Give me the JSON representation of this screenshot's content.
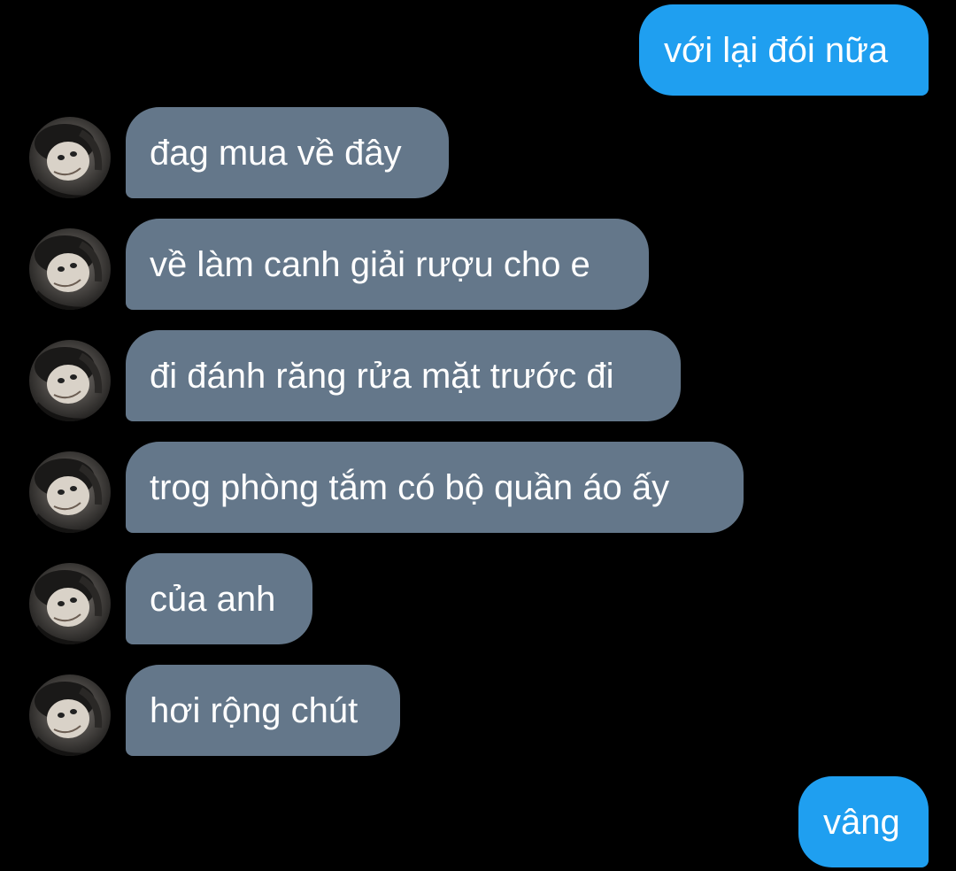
{
  "messages": [
    {
      "side": "sent",
      "text": "với lại đói nữa"
    },
    {
      "side": "received",
      "text": "đag mua về đây",
      "avatar": "user-photo-avatar"
    },
    {
      "side": "received",
      "text": "về làm canh giải rượu cho e",
      "avatar": "user-photo-avatar"
    },
    {
      "side": "received",
      "text": "đi đánh răng rửa mặt trước đi",
      "avatar": "user-photo-avatar"
    },
    {
      "side": "received",
      "text": "trog phòng tắm có bộ quần áo ấy",
      "avatar": "user-photo-avatar"
    },
    {
      "side": "received",
      "text": "của anh",
      "avatar": "user-photo-avatar"
    },
    {
      "side": "received",
      "text": "hơi rộng chút",
      "avatar": "user-photo-avatar"
    },
    {
      "side": "sent",
      "text": "vâng"
    }
  ],
  "colors": {
    "background": "#000000",
    "sent_bubble": "#1f9ff0",
    "received_bubble": "#64778a",
    "text": "#ffffff"
  }
}
